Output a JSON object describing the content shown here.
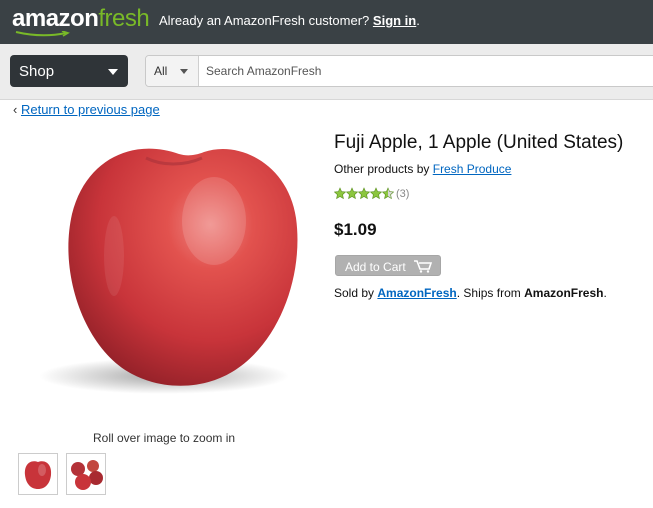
{
  "header": {
    "logo_text_1": "amazon",
    "logo_text_2": "fresh",
    "prompt": "Already an AmazonFresh customer?",
    "signin_link": "Sign in",
    "signin_tail": "."
  },
  "nav": {
    "shop_label": "Shop",
    "category_label": "All",
    "search_placeholder": "Search AmazonFresh"
  },
  "breadcrumb": {
    "chevron": "‹",
    "return_label": "Return to previous page"
  },
  "product": {
    "title": "Fuji Apple, 1 Apple (United States)",
    "other_prefix": "Other products by",
    "brand_link": "Fresh Produce",
    "rating_stars": 4.5,
    "review_count": "(3)",
    "price": "$1.09",
    "add_to_cart": "Add to Cart",
    "sold_prefix": "Sold by",
    "seller_link": "AmazonFresh",
    "ships_text": ". Ships from",
    "ships_from": "AmazonFresh",
    "end_punct": "."
  },
  "gallery": {
    "zoom_hint": "Roll over image to zoom in",
    "thumbnails": [
      "single-apple-thumb",
      "apple-group-thumb"
    ]
  },
  "colors": {
    "topbar": "#3a4145",
    "logo_accent": "#79b928",
    "link": "#0066c0",
    "star": "#8cc63f"
  }
}
